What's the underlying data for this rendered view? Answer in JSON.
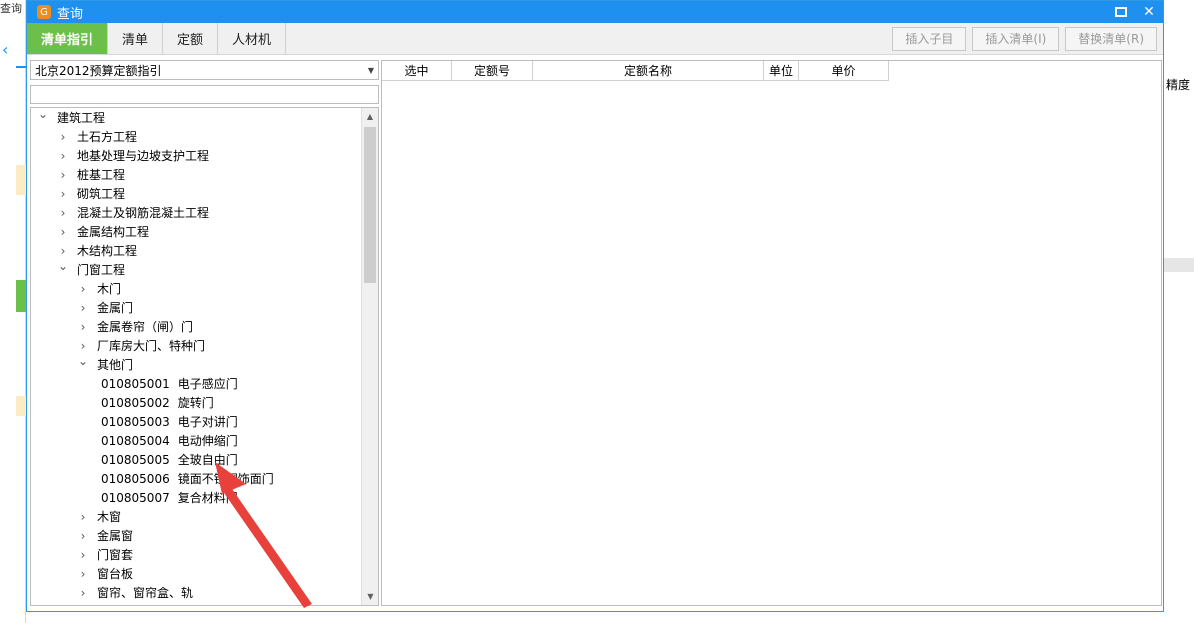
{
  "background_app": {
    "top_left_text": "查询",
    "right_header": "精度"
  },
  "dialog": {
    "title": "查询",
    "minimize_icon": "maximize-icon",
    "close_icon": "close-icon",
    "tabs": [
      {
        "label": "清单指引",
        "active": true
      },
      {
        "label": "清单",
        "active": false
      },
      {
        "label": "定额",
        "active": false
      },
      {
        "label": "人材机",
        "active": false
      }
    ],
    "actions": {
      "insert_child": "插入子目",
      "insert_list": "插入清单(I)",
      "replace_list": "替换清单(R)"
    }
  },
  "left_panel": {
    "library_select": "北京2012预算定额指引",
    "search_value": "",
    "tree": [
      {
        "level": 0,
        "expanded": true,
        "label": "建筑工程"
      },
      {
        "level": 1,
        "expanded": false,
        "label": "土石方工程"
      },
      {
        "level": 1,
        "expanded": false,
        "label": "地基处理与边坡支护工程"
      },
      {
        "level": 1,
        "expanded": false,
        "label": "桩基工程"
      },
      {
        "level": 1,
        "expanded": false,
        "label": "砌筑工程"
      },
      {
        "level": 1,
        "expanded": false,
        "label": "混凝土及钢筋混凝土工程"
      },
      {
        "level": 1,
        "expanded": false,
        "label": "金属结构工程"
      },
      {
        "level": 1,
        "expanded": false,
        "label": "木结构工程"
      },
      {
        "level": 1,
        "expanded": true,
        "label": "门窗工程"
      },
      {
        "level": 2,
        "expanded": false,
        "label": "木门"
      },
      {
        "level": 2,
        "expanded": false,
        "label": "金属门"
      },
      {
        "level": 2,
        "expanded": false,
        "label": "金属卷帘（闸）门"
      },
      {
        "level": 2,
        "expanded": false,
        "label": "厂库房大门、特种门"
      },
      {
        "level": 2,
        "expanded": true,
        "label": "其他门"
      },
      {
        "level": 3,
        "leaf": true,
        "code": "010805001",
        "label": "电子感应门"
      },
      {
        "level": 3,
        "leaf": true,
        "code": "010805002",
        "label": "旋转门"
      },
      {
        "level": 3,
        "leaf": true,
        "code": "010805003",
        "label": "电子对讲门"
      },
      {
        "level": 3,
        "leaf": true,
        "code": "010805004",
        "label": "电动伸缩门"
      },
      {
        "level": 3,
        "leaf": true,
        "code": "010805005",
        "label": "全玻自由门"
      },
      {
        "level": 3,
        "leaf": true,
        "code": "010805006",
        "label": "镜面不锈钢饰面门"
      },
      {
        "level": 3,
        "leaf": true,
        "code": "010805007",
        "label": "复合材料门"
      },
      {
        "level": 2,
        "expanded": false,
        "label": "木窗"
      },
      {
        "level": 2,
        "expanded": false,
        "label": "金属窗"
      },
      {
        "level": 2,
        "expanded": false,
        "label": "门窗套"
      },
      {
        "level": 2,
        "expanded": false,
        "label": "窗台板"
      },
      {
        "level": 2,
        "expanded": false,
        "label": "窗帘、窗帘盒、轨"
      }
    ]
  },
  "grid": {
    "columns": [
      "选中",
      "定额号",
      "定额名称",
      "单位",
      "单价"
    ]
  },
  "colors": {
    "title_bar": "#1e90f0",
    "active_tab": "#6cc04a",
    "annotation_arrow": "#e8413c"
  }
}
